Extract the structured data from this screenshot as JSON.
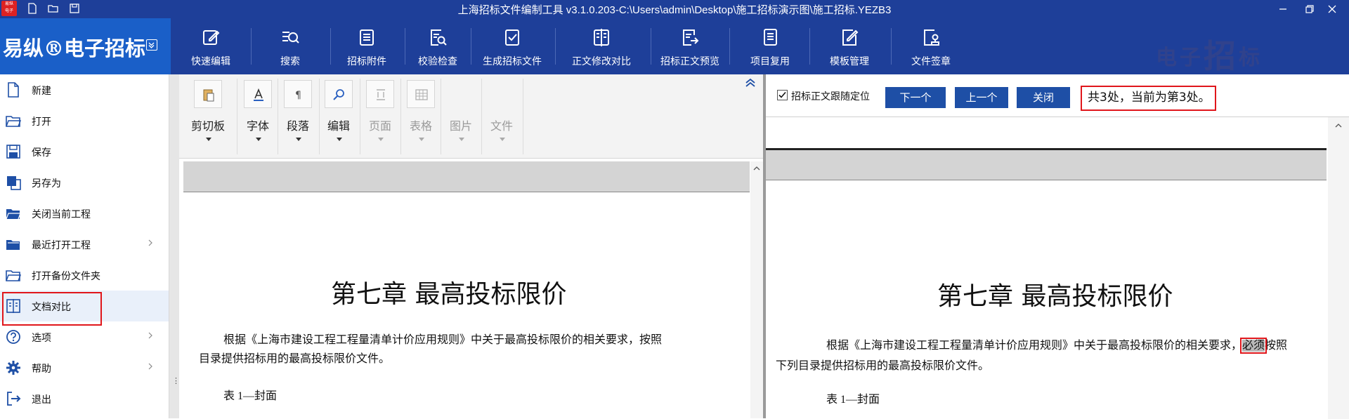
{
  "window": {
    "title": "上海招标文件编制工具 v3.1.0.203-C:\\Users\\admin\\Desktop\\施工招标演示图\\施工招标.YEZB3"
  },
  "brand": {
    "logo_text": "易纵®电子招标",
    "watermark_small": "电子",
    "watermark_big": "招",
    "watermark_tail": "标"
  },
  "toolbar": {
    "items": [
      {
        "label": "快速编辑",
        "icon": "edit-icon"
      },
      {
        "label": "搜索",
        "icon": "search-list-icon"
      },
      {
        "label": "招标附件",
        "icon": "clipboard-icon"
      },
      {
        "label": "校验检查",
        "icon": "doc-search-icon"
      },
      {
        "label": "生成招标文件",
        "icon": "check-clipboard-icon"
      },
      {
        "label": "正文修改对比",
        "icon": "compare-icon"
      },
      {
        "label": "招标正文预览",
        "icon": "preview-icon"
      },
      {
        "label": "项目复用",
        "icon": "reuse-icon"
      },
      {
        "label": "模板管理",
        "icon": "template-icon"
      },
      {
        "label": "文件签章",
        "icon": "seal-icon"
      }
    ]
  },
  "sidebar": {
    "items": [
      {
        "label": "新建",
        "icon": "new-file-icon"
      },
      {
        "label": "打开",
        "icon": "open-folder-icon"
      },
      {
        "label": "保存",
        "icon": "save-icon"
      },
      {
        "label": "另存为",
        "icon": "save-as-icon"
      },
      {
        "label": "关闭当前工程",
        "icon": "close-project-icon"
      },
      {
        "label": "最近打开工程",
        "icon": "recent-folder-icon"
      },
      {
        "label": "打开备份文件夹",
        "icon": "backup-folder-icon"
      },
      {
        "label": "文档对比",
        "icon": "compare-doc-icon"
      },
      {
        "label": "选项",
        "icon": "help-circle-icon"
      },
      {
        "label": "帮助",
        "icon": "gear-icon"
      },
      {
        "label": "退出",
        "icon": "exit-icon"
      }
    ]
  },
  "editor_ribbon": {
    "groups": [
      {
        "label": "剪切板",
        "enabled": true
      },
      {
        "label": "字体",
        "enabled": true
      },
      {
        "label": "段落",
        "enabled": true
      },
      {
        "label": "编辑",
        "enabled": true
      },
      {
        "label": "页面",
        "enabled": false
      },
      {
        "label": "表格",
        "enabled": false
      },
      {
        "label": "图片",
        "enabled": false
      },
      {
        "label": "文件",
        "enabled": false
      }
    ]
  },
  "left_doc": {
    "heading": "第七章  最高投标限价",
    "para1": "根据《上海市建设工程工程量清单计价应用规则》中关于最高投标限价的相关要求，按照",
    "para2": "目录提供招标用的最高投标限价文件。",
    "para3": "表 1—封面"
  },
  "find_bar": {
    "checkbox_label": "招标正文跟随定位",
    "checked": true,
    "next_label": "下一个",
    "prev_label": "上一个",
    "close_label": "关闭",
    "status": "共3处，当前为第3处。"
  },
  "right_doc": {
    "heading": "第七章  最高投标限价",
    "para1_a": "根据《上海市建设工程工程量清单计价应用规则》中关于最高投标限价的相关要求，",
    "highlight": "必须",
    "para1_b": "按照",
    "para2": "下列目录提供招标用的最高投标限价文件。",
    "para3": "表  1—封面"
  },
  "colors": {
    "titlebar": "#1e3f99",
    "logo_bg": "#1a5fc8",
    "button": "#1e4fa6",
    "highlight_border": "#e0161b"
  }
}
